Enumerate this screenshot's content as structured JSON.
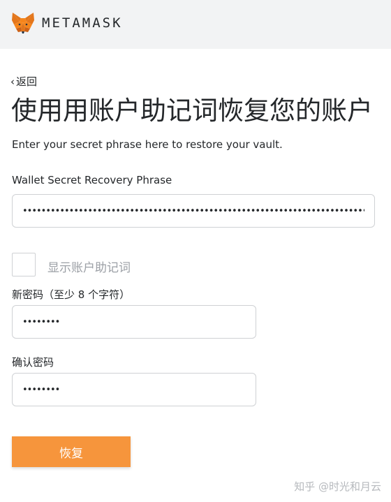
{
  "header": {
    "brand": "METAMASK",
    "logo_icon": "metamask-fox-icon"
  },
  "nav": {
    "back_chevron": "‹",
    "back_label": "返回"
  },
  "page": {
    "title": "使用用账户助记词恢复您的账户",
    "subtitle": "Enter your secret phrase here to restore your vault."
  },
  "form": {
    "phrase_label": "Wallet Secret Recovery Phrase",
    "phrase_value": "•••••••••••••••••••••••••••••••••••••••••••••••••••••••••••••••••••••••••••••••",
    "show_phrase_label": "显示账户助记词",
    "show_phrase_checked": false,
    "new_password_label": "新密码（至少 8 个字符）",
    "new_password_value": "••••••••",
    "confirm_password_label": "确认密码",
    "confirm_password_value": "••••••••",
    "restore_button": "恢复"
  },
  "watermark": "知乎 @时光和月云",
  "colors": {
    "header_bg": "#f2f3f4",
    "button_orange": "#f6953c",
    "text": "#24272a",
    "muted_text": "#9b9fa5",
    "border": "#cfd1d4"
  }
}
